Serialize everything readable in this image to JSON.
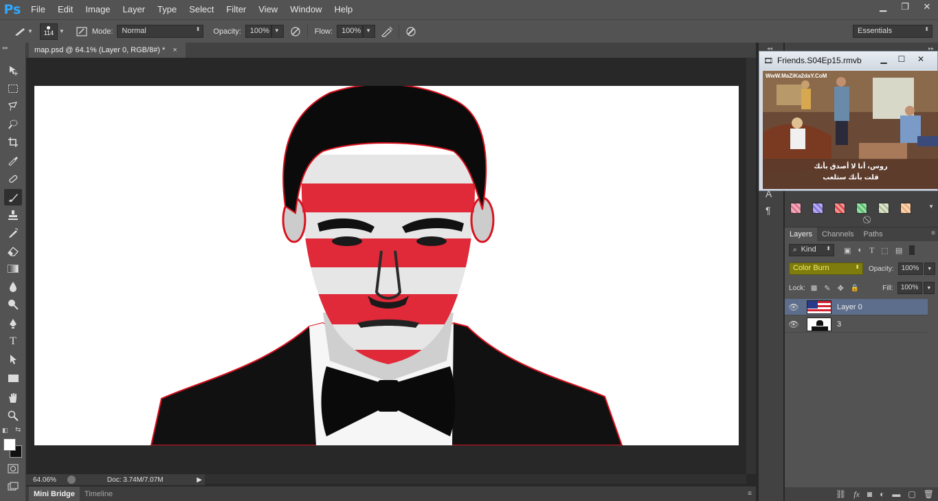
{
  "app": {
    "logo": "Ps"
  },
  "menu": [
    "File",
    "Edit",
    "Image",
    "Layer",
    "Type",
    "Select",
    "Filter",
    "View",
    "Window",
    "Help"
  ],
  "window_controls": {
    "minimize": "▁",
    "restore": "❐",
    "close": "✕"
  },
  "options_bar": {
    "brush_size": "114",
    "mode_label": "Mode:",
    "mode_value": "Normal",
    "opacity_label": "Opacity:",
    "opacity_value": "100%",
    "flow_label": "Flow:",
    "flow_value": "100%",
    "workspace": "Essentials"
  },
  "document": {
    "tab_title": "map.psd @ 64.1% (Layer 0, RGB/8#) *",
    "zoom": "64.06%",
    "doc_size": "Doc: 3.74M/7.07M"
  },
  "bottom_tabs": [
    "Mini Bridge",
    "Timeline"
  ],
  "video": {
    "title": "Friends.S04Ep15.rmvb",
    "watermark": "WwW.MaZiKa2daY.CoM",
    "subtitle_line1": "روس، أنا لا أصدق بأنك",
    "subtitle_line2": "قلت بأنك ستلعب"
  },
  "layers_panel": {
    "tabs": [
      "Layers",
      "Channels",
      "Paths"
    ],
    "kind_label": "Kind",
    "blend_mode": "Color Burn",
    "opacity_label": "Opacity:",
    "opacity_value": "100%",
    "lock_label": "Lock:",
    "fill_label": "Fill:",
    "fill_value": "100%",
    "layers": [
      {
        "name": "Layer 0",
        "selected": true
      },
      {
        "name": "3",
        "selected": false
      }
    ]
  },
  "colors": {
    "accent_red": "#e0192a",
    "ui_panel": "#535353",
    "ui_dark": "#282828",
    "selected_layer": "#5d6e8c",
    "blend_highlight": "#7d7c0c"
  }
}
